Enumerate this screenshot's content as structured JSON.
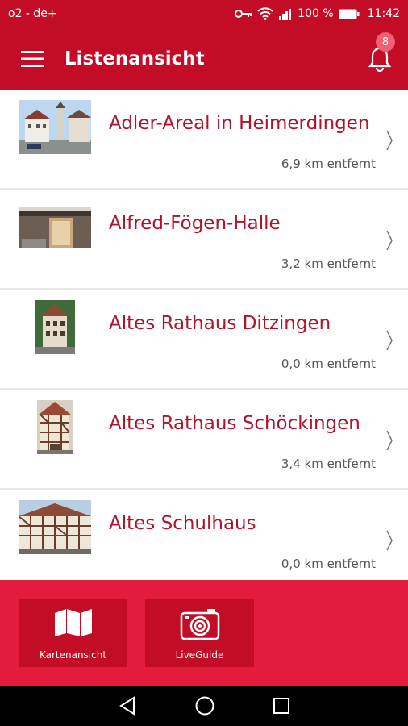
{
  "status": {
    "carrier": "o2 - de+",
    "battery": "100 %",
    "time": "11:42"
  },
  "appbar": {
    "title": "Listenansicht",
    "badge_count": "8"
  },
  "items": [
    {
      "title": "Adler-Areal in Heimerdingen",
      "distance": "6,9 km entfernt"
    },
    {
      "title": "Alfred-Fögen-Halle",
      "distance": "3,2 km entfernt"
    },
    {
      "title": "Altes Rathaus Ditzingen",
      "distance": "0,0 km entfernt"
    },
    {
      "title": "Altes Rathaus Schöckingen",
      "distance": "3,4 km entfernt"
    },
    {
      "title": "Altes Schulhaus",
      "distance": "0,0 km entfernt"
    }
  ],
  "bottom": {
    "map_label": "Kartenansicht",
    "live_label": "LiveGuide"
  },
  "colors": {
    "primary": "#c30d26",
    "accent": "#e31b3c",
    "title_text": "#b0132a"
  }
}
